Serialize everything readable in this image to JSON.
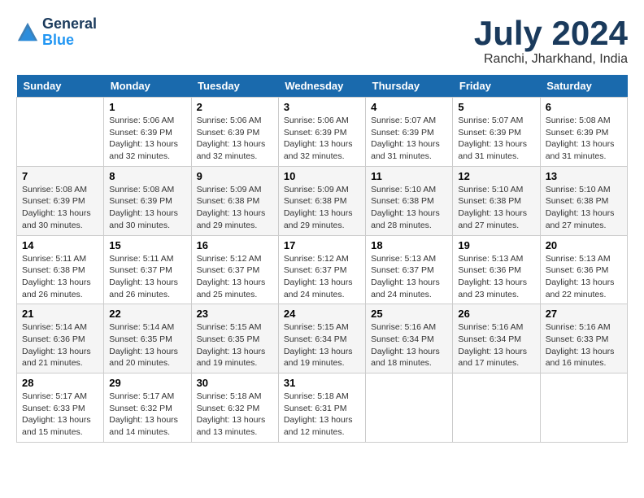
{
  "header": {
    "logo_line1": "General",
    "logo_line2": "Blue",
    "month": "July 2024",
    "location": "Ranchi, Jharkhand, India"
  },
  "weekdays": [
    "Sunday",
    "Monday",
    "Tuesday",
    "Wednesday",
    "Thursday",
    "Friday",
    "Saturday"
  ],
  "weeks": [
    [
      {
        "day": "",
        "info": ""
      },
      {
        "day": "1",
        "info": "Sunrise: 5:06 AM\nSunset: 6:39 PM\nDaylight: 13 hours\nand 32 minutes."
      },
      {
        "day": "2",
        "info": "Sunrise: 5:06 AM\nSunset: 6:39 PM\nDaylight: 13 hours\nand 32 minutes."
      },
      {
        "day": "3",
        "info": "Sunrise: 5:06 AM\nSunset: 6:39 PM\nDaylight: 13 hours\nand 32 minutes."
      },
      {
        "day": "4",
        "info": "Sunrise: 5:07 AM\nSunset: 6:39 PM\nDaylight: 13 hours\nand 31 minutes."
      },
      {
        "day": "5",
        "info": "Sunrise: 5:07 AM\nSunset: 6:39 PM\nDaylight: 13 hours\nand 31 minutes."
      },
      {
        "day": "6",
        "info": "Sunrise: 5:08 AM\nSunset: 6:39 PM\nDaylight: 13 hours\nand 31 minutes."
      }
    ],
    [
      {
        "day": "7",
        "info": "Sunrise: 5:08 AM\nSunset: 6:39 PM\nDaylight: 13 hours\nand 30 minutes."
      },
      {
        "day": "8",
        "info": "Sunrise: 5:08 AM\nSunset: 6:39 PM\nDaylight: 13 hours\nand 30 minutes."
      },
      {
        "day": "9",
        "info": "Sunrise: 5:09 AM\nSunset: 6:38 PM\nDaylight: 13 hours\nand 29 minutes."
      },
      {
        "day": "10",
        "info": "Sunrise: 5:09 AM\nSunset: 6:38 PM\nDaylight: 13 hours\nand 29 minutes."
      },
      {
        "day": "11",
        "info": "Sunrise: 5:10 AM\nSunset: 6:38 PM\nDaylight: 13 hours\nand 28 minutes."
      },
      {
        "day": "12",
        "info": "Sunrise: 5:10 AM\nSunset: 6:38 PM\nDaylight: 13 hours\nand 27 minutes."
      },
      {
        "day": "13",
        "info": "Sunrise: 5:10 AM\nSunset: 6:38 PM\nDaylight: 13 hours\nand 27 minutes."
      }
    ],
    [
      {
        "day": "14",
        "info": "Sunrise: 5:11 AM\nSunset: 6:38 PM\nDaylight: 13 hours\nand 26 minutes."
      },
      {
        "day": "15",
        "info": "Sunrise: 5:11 AM\nSunset: 6:37 PM\nDaylight: 13 hours\nand 26 minutes."
      },
      {
        "day": "16",
        "info": "Sunrise: 5:12 AM\nSunset: 6:37 PM\nDaylight: 13 hours\nand 25 minutes."
      },
      {
        "day": "17",
        "info": "Sunrise: 5:12 AM\nSunset: 6:37 PM\nDaylight: 13 hours\nand 24 minutes."
      },
      {
        "day": "18",
        "info": "Sunrise: 5:13 AM\nSunset: 6:37 PM\nDaylight: 13 hours\nand 24 minutes."
      },
      {
        "day": "19",
        "info": "Sunrise: 5:13 AM\nSunset: 6:36 PM\nDaylight: 13 hours\nand 23 minutes."
      },
      {
        "day": "20",
        "info": "Sunrise: 5:13 AM\nSunset: 6:36 PM\nDaylight: 13 hours\nand 22 minutes."
      }
    ],
    [
      {
        "day": "21",
        "info": "Sunrise: 5:14 AM\nSunset: 6:36 PM\nDaylight: 13 hours\nand 21 minutes."
      },
      {
        "day": "22",
        "info": "Sunrise: 5:14 AM\nSunset: 6:35 PM\nDaylight: 13 hours\nand 20 minutes."
      },
      {
        "day": "23",
        "info": "Sunrise: 5:15 AM\nSunset: 6:35 PM\nDaylight: 13 hours\nand 19 minutes."
      },
      {
        "day": "24",
        "info": "Sunrise: 5:15 AM\nSunset: 6:34 PM\nDaylight: 13 hours\nand 19 minutes."
      },
      {
        "day": "25",
        "info": "Sunrise: 5:16 AM\nSunset: 6:34 PM\nDaylight: 13 hours\nand 18 minutes."
      },
      {
        "day": "26",
        "info": "Sunrise: 5:16 AM\nSunset: 6:34 PM\nDaylight: 13 hours\nand 17 minutes."
      },
      {
        "day": "27",
        "info": "Sunrise: 5:16 AM\nSunset: 6:33 PM\nDaylight: 13 hours\nand 16 minutes."
      }
    ],
    [
      {
        "day": "28",
        "info": "Sunrise: 5:17 AM\nSunset: 6:33 PM\nDaylight: 13 hours\nand 15 minutes."
      },
      {
        "day": "29",
        "info": "Sunrise: 5:17 AM\nSunset: 6:32 PM\nDaylight: 13 hours\nand 14 minutes."
      },
      {
        "day": "30",
        "info": "Sunrise: 5:18 AM\nSunset: 6:32 PM\nDaylight: 13 hours\nand 13 minutes."
      },
      {
        "day": "31",
        "info": "Sunrise: 5:18 AM\nSunset: 6:31 PM\nDaylight: 13 hours\nand 12 minutes."
      },
      {
        "day": "",
        "info": ""
      },
      {
        "day": "",
        "info": ""
      },
      {
        "day": "",
        "info": ""
      }
    ]
  ]
}
